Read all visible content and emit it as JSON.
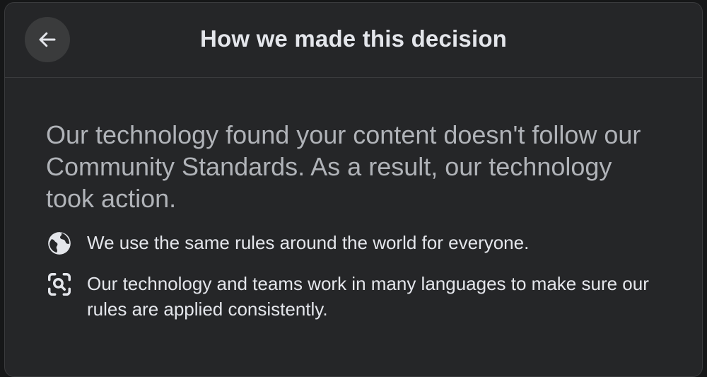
{
  "dialog": {
    "title": "How we made this decision",
    "back_icon": "arrow-left-icon"
  },
  "content": {
    "lead": "Our technology found your content doesn't follow our Community Standards. As a result, our technology took action.",
    "items": [
      {
        "icon": "globe-icon",
        "text": "We use the same rules around the world for everyone."
      },
      {
        "icon": "scan-search-icon",
        "text": "Our technology and teams work in many languages to make sure our rules are applied consistently."
      }
    ]
  },
  "colors": {
    "background": "#252628",
    "title": "#e4e6eb",
    "lead_text": "#b0b3b8",
    "body_text": "#e4e6eb",
    "button_bg": "#3a3b3c"
  }
}
